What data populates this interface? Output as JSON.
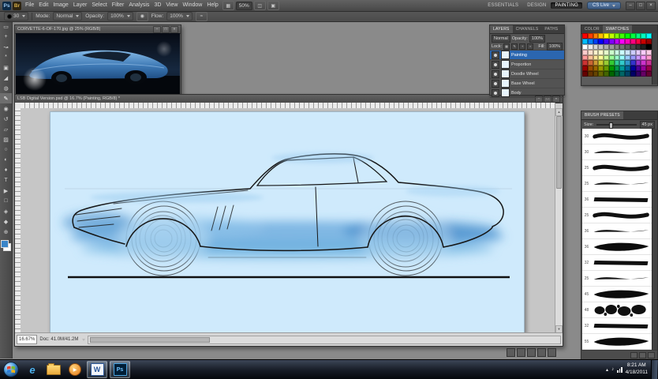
{
  "app": {
    "logo": "Ps",
    "bridge": "Br",
    "menus": [
      "File",
      "Edit",
      "Image",
      "Layer",
      "Select",
      "Filter",
      "Analysis",
      "3D",
      "View",
      "Window",
      "Help"
    ],
    "zoom_value": "50%",
    "workspaces": [
      "ESSENTIALS",
      "DESIGN",
      "PAINTING"
    ],
    "active_workspace": "PAINTING",
    "cs_live_label": "CS Live",
    "window_buttons": [
      "–",
      "□",
      "×"
    ]
  },
  "options_bar": {
    "brush_size": "30",
    "mode_label": "Mode:",
    "mode_value": "Normal",
    "opacity_label": "Opacity:",
    "opacity_value": "100%",
    "flow_label": "Flow:",
    "flow_value": "100%"
  },
  "tools": [
    "rectangular-marquee",
    "move",
    "lasso",
    "quick-selection",
    "crop",
    "eyedropper",
    "spot-healing",
    "brush",
    "clone-stamp",
    "history-brush",
    "eraser",
    "gradient",
    "blur",
    "dodge",
    "pen",
    "type",
    "path-selection",
    "rectangle",
    "rotate-view",
    "hand",
    "zoom"
  ],
  "reference_window": {
    "title": "CORVETTE-6-OF-170.jpg @ 25% (RGB/8)"
  },
  "document_window": {
    "title": "LSB Digital Version.psd @ 16.7% (Painting, RGB/8) *",
    "zoom": "16.67%",
    "doc_info": "Doc: 41.0M/41.2M"
  },
  "layers_panel": {
    "tabs": [
      "LAYERS",
      "CHANNELS",
      "PATHS"
    ],
    "blend_mode": "Normal",
    "opacity_label": "Opacity:",
    "opacity_value": "100%",
    "lock_label": "Lock:",
    "fill_label": "Fill:",
    "fill_value": "100%",
    "layers": [
      {
        "name": "Painting",
        "selected": true
      },
      {
        "name": "Proportion",
        "selected": false
      },
      {
        "name": "Doodle Wheel",
        "selected": false
      },
      {
        "name": "Base Wheel",
        "selected": false
      },
      {
        "name": "Body",
        "selected": false
      }
    ]
  },
  "swatches_panel": {
    "tabs": [
      "COLOR",
      "SWATCHES"
    ],
    "active_tab": "SWATCHES",
    "colors": [
      "#ff0000",
      "#ff4000",
      "#ff8000",
      "#ffbf00",
      "#ffff00",
      "#bfff00",
      "#80ff00",
      "#40ff00",
      "#00ff00",
      "#00ff40",
      "#00ff80",
      "#00ffbf",
      "#00ffff",
      "#00bfff",
      "#0080ff",
      "#0040ff",
      "#0000ff",
      "#4000ff",
      "#8000ff",
      "#bf00ff",
      "#ff00ff",
      "#ff00bf",
      "#ff0080",
      "#ff0040",
      "#cc0000",
      "#990000",
      "#ffffff",
      "#ebebeb",
      "#d6d6d6",
      "#c2c2c2",
      "#adadad",
      "#999999",
      "#858585",
      "#707070",
      "#5c5c5c",
      "#474747",
      "#333333",
      "#1f1f1f",
      "#000000",
      "#ffcccc",
      "#ffe0cc",
      "#fff2cc",
      "#ffffcc",
      "#e6ffcc",
      "#ccffcc",
      "#ccffe6",
      "#ccffff",
      "#cce6ff",
      "#ccccff",
      "#e6ccff",
      "#ffccff",
      "#ffcce6",
      "#ff9999",
      "#ffc299",
      "#ffe699",
      "#ffff99",
      "#ccff99",
      "#99ff99",
      "#99ffcc",
      "#99ffff",
      "#99ccff",
      "#9999ff",
      "#cc99ff",
      "#ff99ff",
      "#ff99cc",
      "#cc3333",
      "#cc6633",
      "#cc9933",
      "#cccc33",
      "#99cc33",
      "#33cc33",
      "#33cc99",
      "#33cccc",
      "#3399cc",
      "#3333cc",
      "#9933cc",
      "#cc33cc",
      "#cc3399",
      "#990000",
      "#994d00",
      "#996600",
      "#999900",
      "#669900",
      "#009900",
      "#00994d",
      "#009999",
      "#006699",
      "#000099",
      "#4d0099",
      "#990099",
      "#99004d",
      "#660000",
      "#663300",
      "#664400",
      "#666600",
      "#446600",
      "#006600",
      "#006633",
      "#006666",
      "#004466",
      "#000066",
      "#330066",
      "#660066",
      "#660033"
    ]
  },
  "brush_panel": {
    "tab": "BRUSH PRESETS",
    "size_label": "Size:",
    "size_value": "45 px",
    "brushes": [
      {
        "size": 30,
        "style": "round"
      },
      {
        "size": 30,
        "style": "taper"
      },
      {
        "size": 25,
        "style": "round"
      },
      {
        "size": 25,
        "style": "taper"
      },
      {
        "size": 36,
        "style": "flat"
      },
      {
        "size": 25,
        "style": "round"
      },
      {
        "size": 36,
        "style": "taper"
      },
      {
        "size": 36,
        "style": "fat"
      },
      {
        "size": 32,
        "style": "flat"
      },
      {
        "size": 25,
        "style": "taper"
      },
      {
        "size": 45,
        "style": "fat"
      },
      {
        "size": 48,
        "style": "spatter"
      },
      {
        "size": 32,
        "style": "flat"
      },
      {
        "size": 55,
        "style": "fat"
      }
    ]
  },
  "taskbar": {
    "time": "8:21 AM",
    "date": "4/18/2011"
  },
  "colors": {
    "foreground": "#3a85c8",
    "canvas_bg": "#cfeafc",
    "selection_blue": "#2b66b0"
  }
}
